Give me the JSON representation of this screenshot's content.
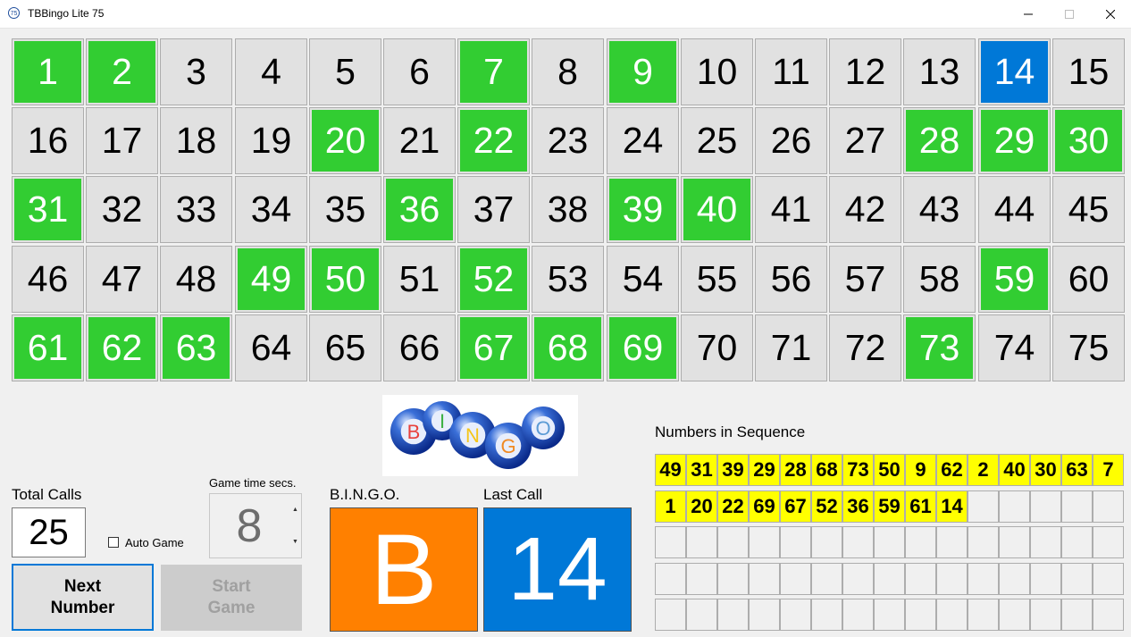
{
  "window": {
    "title": "TBBingo Lite 75",
    "icon_text": "75"
  },
  "board": {
    "numbers": [
      1,
      2,
      3,
      4,
      5,
      6,
      7,
      8,
      9,
      10,
      11,
      12,
      13,
      14,
      15,
      16,
      17,
      18,
      19,
      20,
      21,
      22,
      23,
      24,
      25,
      26,
      27,
      28,
      29,
      30,
      31,
      32,
      33,
      34,
      35,
      36,
      37,
      38,
      39,
      40,
      41,
      42,
      43,
      44,
      45,
      46,
      47,
      48,
      49,
      50,
      51,
      52,
      53,
      54,
      55,
      56,
      57,
      58,
      59,
      60,
      61,
      62,
      63,
      64,
      65,
      66,
      67,
      68,
      69,
      70,
      71,
      72,
      73,
      74,
      75
    ],
    "called": [
      1,
      2,
      7,
      9,
      20,
      22,
      28,
      29,
      30,
      31,
      36,
      39,
      40,
      49,
      50,
      52,
      59,
      61,
      62,
      63,
      67,
      68,
      69,
      73
    ],
    "last": 14,
    "colors": {
      "called": "#32cd32",
      "last": "#0078d7"
    }
  },
  "logo": {
    "letters": [
      "B",
      "I",
      "N",
      "G",
      "O"
    ],
    "letter_colors": [
      "#e8413c",
      "#3cb043",
      "#f5c518",
      "#f08a24",
      "#5b9bd5"
    ]
  },
  "controls": {
    "total_calls_label": "Total Calls",
    "total_calls_value": "25",
    "auto_game_label": "Auto Game",
    "game_time_label": "Game time secs.",
    "game_time_value": "8",
    "next_button": "Next Number",
    "start_button": "Start Game"
  },
  "display": {
    "bingo_label": "B.I.N.G.O.",
    "bingo_letter": "B",
    "last_call_label": "Last Call",
    "last_call_value": "14"
  },
  "sequence": {
    "label": "Numbers in Sequence",
    "numbers": [
      "49",
      "31",
      "39",
      "29",
      "28",
      "68",
      "73",
      "50",
      "9",
      "62",
      "2",
      "40",
      "30",
      "63",
      "7",
      "1",
      "20",
      "22",
      "69",
      "67",
      "52",
      "36",
      "59",
      "61",
      "14"
    ],
    "total_slots": 75
  }
}
